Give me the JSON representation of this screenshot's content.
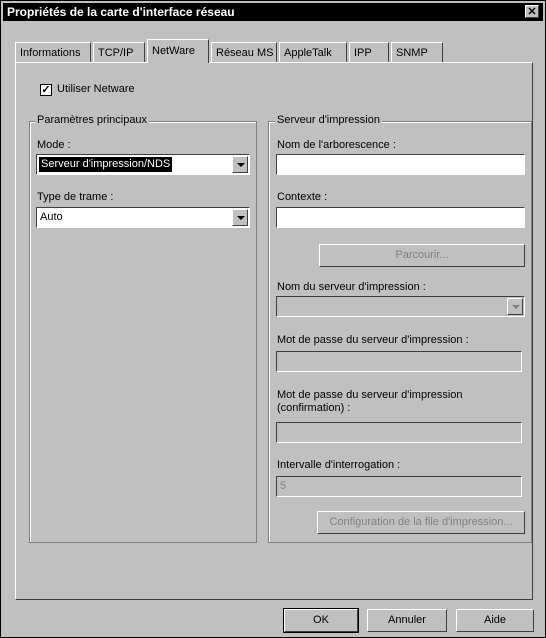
{
  "window": {
    "title": "Propriétés de la carte d'interface réseau",
    "close_glyph": "✕"
  },
  "tabs": [
    {
      "label": "Informations",
      "active": false
    },
    {
      "label": "TCP/IP",
      "active": false
    },
    {
      "label": "NetWare",
      "active": true
    },
    {
      "label": "Réseau MS",
      "active": false
    },
    {
      "label": "AppleTalk",
      "active": false
    },
    {
      "label": "IPP",
      "active": false
    },
    {
      "label": "SNMP",
      "active": false
    }
  ],
  "netware": {
    "use_netware": {
      "label": "Utiliser Netware",
      "checked": true,
      "check_glyph": "✓"
    }
  },
  "main_params": {
    "title": "Paramètres principaux",
    "mode_label": "Mode :",
    "mode_value": "Serveur d'impression/NDS",
    "frame_label": "Type de trame :",
    "frame_value": "Auto"
  },
  "print_server": {
    "title": "Serveur d'impression",
    "tree_label": "Nom de l'arborescence :",
    "tree_value": "",
    "context_label": "Contexte :",
    "context_value": "",
    "browse_label": "Parcourir...",
    "server_name_label": "Nom du serveur d'impression :",
    "server_name_value": "",
    "password_label": "Mot de passe du serveur d'impression :",
    "password_value": "",
    "password_confirm_label_1": "Mot de passe du serveur d'impression",
    "password_confirm_label_2": "(confirmation) :",
    "password_confirm_value": "",
    "poll_label": "Intervalle d'interrogation :",
    "poll_value": "5",
    "queue_config_label": "Configuration de la file d'impression..."
  },
  "footer": {
    "ok_label": "OK",
    "cancel_label": "Annuler",
    "help_label": "Aide"
  }
}
